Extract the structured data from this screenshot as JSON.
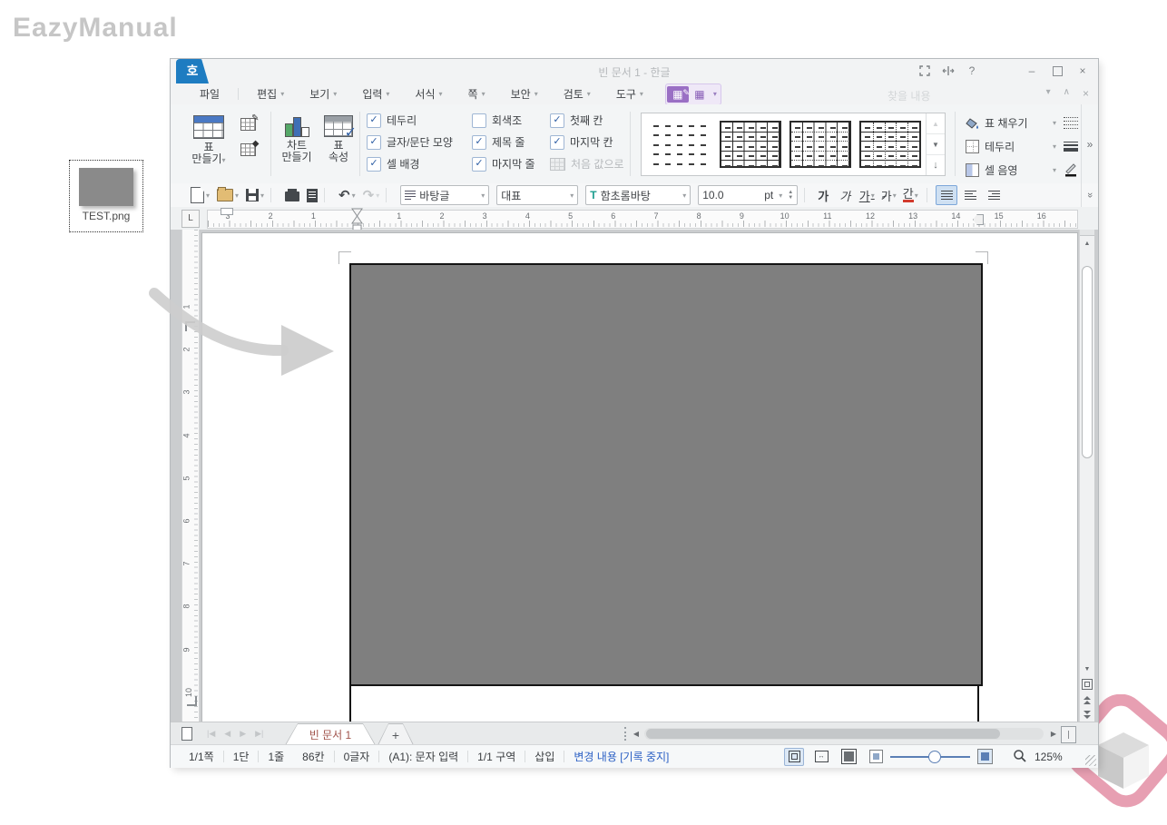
{
  "brand": {
    "watermark": "EazyManual"
  },
  "desktop": {
    "file_label": "TEST.png"
  },
  "icons": {
    "chevron_down": "▾",
    "more": "»",
    "undo": "↶",
    "redo": "↷",
    "help": "?",
    "minimize": "–",
    "close": "×",
    "collapse": "∧",
    "scroll_up": "▲",
    "scroll_down": "▼",
    "scroll_left": "◀",
    "scroll_right": "▶",
    "nav_first": "|◀",
    "nav_prev": "◀",
    "nav_next": "▶",
    "nav_last": "▶|",
    "gallery_up": "▲",
    "gallery_down": "▼",
    "gallery_more": "↓",
    "plus": "+",
    "tab_guide": "L",
    "check": "✓",
    "scroll_end": "❘"
  },
  "window": {
    "app_char": "호",
    "title": "빈 문서 1 - 한글"
  },
  "menubar": {
    "items": [
      "파일",
      "편집",
      "보기",
      "입력",
      "서식",
      "쪽",
      "보안",
      "검토",
      "도구"
    ],
    "search_placeholder": "찾을 내용"
  },
  "ribbon": {
    "create_table": {
      "line1": "표",
      "line2": "만들기"
    },
    "chart": {
      "line1": "차트",
      "line2": "만들기"
    },
    "table_props": {
      "line1": "표",
      "line2": "속성"
    },
    "checkboxes": [
      {
        "label": "테두리",
        "mark": "✓"
      },
      {
        "label": "글자/문단 모양",
        "mark": "✓"
      },
      {
        "label": "셀 배경",
        "mark": "✓"
      },
      {
        "label": "회색조",
        "mark": ""
      },
      {
        "label": "제목 줄",
        "mark": "✓"
      },
      {
        "label": "마지막 줄",
        "mark": "✓"
      },
      {
        "label": "첫째 칸",
        "mark": "✓"
      },
      {
        "label": "마지막 칸",
        "mark": "✓"
      }
    ],
    "reset_label": "처음 값으로",
    "fill_label": "표 채우기",
    "border_label": "테두리",
    "shading_label": "셀 음영"
  },
  "toolbar": {
    "style_value": "바탕글",
    "preset_value": "대표",
    "font_value": "함초롬바탕",
    "size_value": "10.0",
    "size_unit": "pt",
    "char_buttons": [
      "가",
      "가",
      "가",
      "가",
      "간"
    ]
  },
  "ruler": {
    "h_labels": [
      "3",
      "2",
      "1",
      "",
      "1",
      "2",
      "3",
      "4",
      "5",
      "6",
      "7",
      "8",
      "9",
      "10",
      "11",
      "12",
      "13",
      "14",
      "15",
      "16"
    ],
    "h_start": 22,
    "h_step": 47.2,
    "v_labels": [
      "1",
      "2",
      "3",
      "4",
      "5",
      "6",
      "7",
      "8",
      "9",
      "10"
    ],
    "v_start": 85,
    "v_step": 47.2
  },
  "tabbar": {
    "tab_label": "빈 문서 1"
  },
  "statusbar": {
    "items": [
      "1/1쪽",
      "1단",
      "1줄",
      "86칸",
      "0글자",
      "(A1): 문자 입력",
      "1/1 구역",
      "삽입"
    ],
    "track_changes": "변경 내용 [기록 중지]",
    "zoom_level": "125%"
  },
  "colors": {
    "accent_blue": "#1e7cc1",
    "purple": "#9a6fc4",
    "check_blue": "#2f5fa5",
    "tab_text": "#a0534b",
    "track_changes": "#2a5fc4",
    "image_gray": "#7f7f7f",
    "logo_pink": "#e79fb2"
  }
}
